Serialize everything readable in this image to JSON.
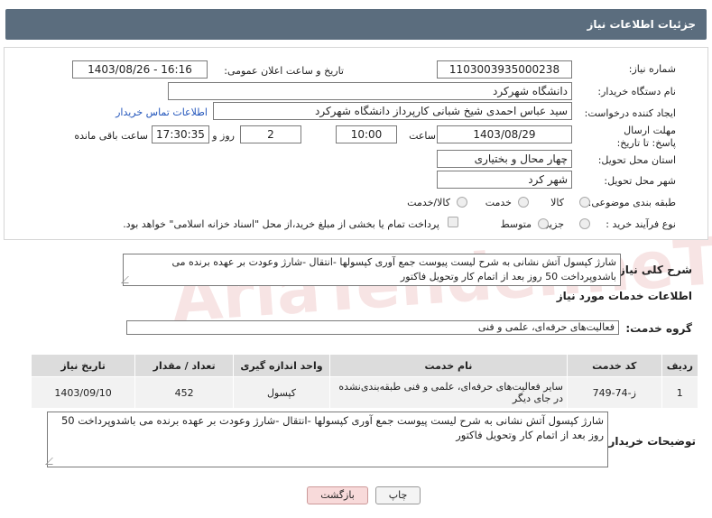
{
  "header": {
    "title": "جزئیات اطلاعات نیاز"
  },
  "fields": {
    "need_number_label": "شماره نیاز:",
    "need_number": "1103003935000238",
    "announce_label": "تاریخ و ساعت اعلان عمومی:",
    "announce_value": "1403/08/26 - 16:16",
    "buyer_org_label": "نام دستگاه خریدار:",
    "buyer_org": "دانشگاه شهرکرد",
    "requester_label": "ایجاد کننده درخواست:",
    "requester": "سید عباس احمدی شیخ شبانی کارپرداز دانشگاه شهرکرد",
    "buyer_contact_link": "اطلاعات تماس خریدار",
    "deadline_label": "مهلت ارسال پاسخ: تا تاریخ:",
    "deadline_date": "1403/08/29",
    "time_label": "ساعت",
    "deadline_time": "10:00",
    "days_value": "2",
    "days_label": "روز و",
    "remaining_value": "17:30:35",
    "remaining_label": "ساعت باقی مانده",
    "province_label": "استان محل تحویل:",
    "province": "چهار محال و بختیاری",
    "city_label": "شهر محل تحویل:",
    "city": "شهر کرد",
    "category_label": "طبقه بندی موضوعی:",
    "category_options": [
      "کالا",
      "خدمت",
      "کالا/خدمت"
    ],
    "process_label": "نوع فرآیند خرید :",
    "process_options": [
      "جزیی",
      "متوسط"
    ],
    "payment_note": "پرداخت تمام یا بخشی از مبلغ خرید،از محل \"اسناد خزانه اسلامی\" خواهد بود."
  },
  "summary": {
    "label": "شرح کلی نیاز:",
    "text": "شارژ کپسول آتش نشانی به شرح لیست پیوست جمع آوری کپسولها -انتقال -شارژ وعودت بر عهده برنده می باشدوپرداخت 50 روز بعد از اتمام کار وتحویل فاکتور"
  },
  "services": {
    "section_title": "اطلاعات خدمات مورد نیاز",
    "group_label": "گروه خدمت:",
    "group_value": "فعالیت‌های حرفه‌ای، علمی و فنی",
    "table": {
      "headers": [
        "ردیف",
        "کد خدمت",
        "نام خدمت",
        "واحد اندازه گیری",
        "تعداد / مقدار",
        "تاریخ نیاز"
      ],
      "rows": [
        [
          "1",
          "ز-74-749",
          "سایر فعالیت‌های حرفه‌ای، علمی و فنی طبقه‌بندی‌نشده در جای دیگر",
          "کپسول",
          "452",
          "1403/09/10"
        ]
      ]
    }
  },
  "buyer_notes": {
    "label": "توضیحات خریدار:",
    "text": "شارژ کپسول آتش نشانی به شرح لیست پیوست جمع آوری کپسولها -انتقال -شارژ وعودت بر عهده برنده می باشدوپرداخت 50 روز بعد از اتمام کار وتحویل فاکتور"
  },
  "buttons": {
    "print": "چاپ",
    "back": "بازگشت"
  },
  "watermark": "AriaTender.neT",
  "colors": {
    "header_bg": "#5b6d7e",
    "link": "#2255bb",
    "back_button_bg": "#f8dada"
  }
}
